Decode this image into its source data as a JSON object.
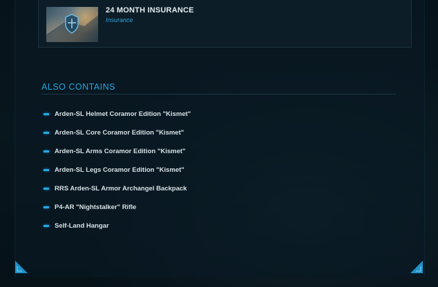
{
  "card": {
    "title": "24 MONTH INSURANCE",
    "subtitle": "Insurance",
    "thumbnail_icon": "shield-icon"
  },
  "also_contains": {
    "heading": "ALSO CONTAINS",
    "items": [
      "Arden-SL Helmet Coramor Edition \"Kismet\"",
      "Arden-SL Core Coramor Edition \"Kismet\"",
      "Arden-SL Arms Coramor Edition \"Kismet\"",
      "Arden-SL Legs Coramor Edition \"Kismet\"",
      "RRS Arden-SL Armor Archangel Backpack",
      "P4-AR \"Nightstalker\" Rifle",
      "Self-Land Hangar"
    ]
  },
  "colors": {
    "accent": "#22a7e2",
    "background": "#061016",
    "text": "#d7e1e6"
  }
}
